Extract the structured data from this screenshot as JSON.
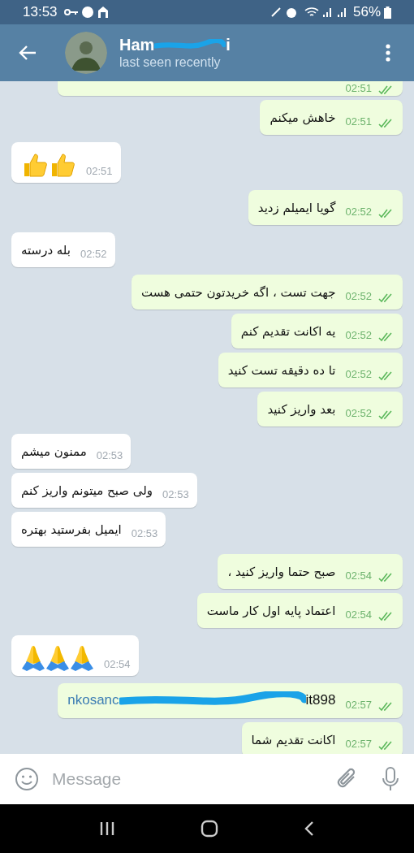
{
  "status_bar": {
    "time": "13:53",
    "battery": "56%"
  },
  "header": {
    "name_start": "Ham",
    "name_end": "i",
    "subtitle": "last seen recently"
  },
  "messages": [
    {
      "kind": "cut_off",
      "outgoing": true,
      "time": "02:51",
      "read": true
    },
    {
      "kind": "text",
      "outgoing": true,
      "text": "خاهش میکنم",
      "time": "02:51",
      "read": true
    },
    {
      "kind": "emoji",
      "outgoing": false,
      "emojis": [
        {
          "kind": "thumbs_up"
        },
        {
          "kind": "thumbs_up"
        }
      ],
      "time": "02:51"
    },
    {
      "kind": "text",
      "outgoing": true,
      "text": "گویا ایمیلم زدید",
      "time": "02:52",
      "read": true
    },
    {
      "kind": "text",
      "outgoing": false,
      "text": "بله درسته",
      "time": "02:52"
    },
    {
      "kind": "text",
      "outgoing": true,
      "text": "جهت تست ، اگه خریدتون حتمی هست",
      "time": "02:52",
      "read": true
    },
    {
      "kind": "text",
      "outgoing": true,
      "text": "یه اکانت تقدیم کنم",
      "time": "02:52",
      "read": true
    },
    {
      "kind": "text",
      "outgoing": true,
      "text": "تا ده دقیقه تست کنید",
      "time": "02:52",
      "read": true
    },
    {
      "kind": "text",
      "outgoing": true,
      "text": "بعد واریز کنید",
      "time": "02:52",
      "read": true
    },
    {
      "kind": "text",
      "outgoing": false,
      "text": "ممنون میشم",
      "time": "02:53"
    },
    {
      "kind": "text",
      "outgoing": false,
      "text": "ولی صبح میتونم واریز کنم",
      "time": "02:53"
    },
    {
      "kind": "text",
      "outgoing": false,
      "text": "ایمیل بفرستید بهتره",
      "time": "02:53"
    },
    {
      "kind": "text",
      "outgoing": true,
      "text": "صبح حتما واریز کنید ،",
      "time": "02:54",
      "read": true
    },
    {
      "kind": "text",
      "outgoing": true,
      "text": "اعتماد پایه اول کار ماست",
      "time": "02:54",
      "read": true
    },
    {
      "kind": "emoji",
      "outgoing": false,
      "emojis": [
        {
          "kind": "praying_hands"
        },
        {
          "kind": "praying_hands"
        },
        {
          "kind": "praying_hands"
        }
      ],
      "time": "02:54"
    },
    {
      "kind": "redacted_link",
      "outgoing": true,
      "link_start": "nkosanc",
      "text_end": "it898",
      "time": "02:57",
      "read": true
    },
    {
      "kind": "text",
      "outgoing": true,
      "text": "اکانت تقدیم شما",
      "time": "02:57",
      "read": true
    }
  ],
  "composer": {
    "placeholder": "Message"
  }
}
